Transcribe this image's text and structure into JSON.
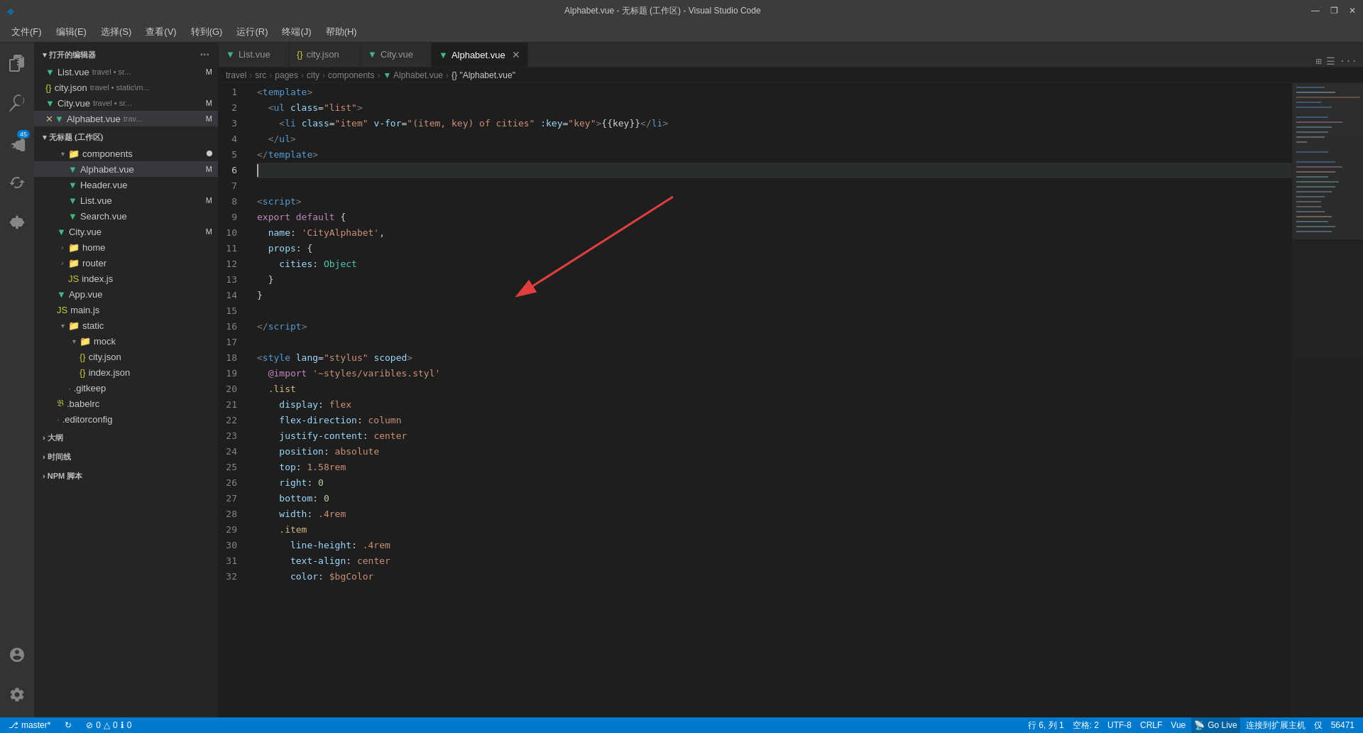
{
  "titleBar": {
    "title": "Alphabet.vue - 无标题 (工作区) - Visual Studio Code",
    "menu": [
      "文件(F)",
      "编辑(E)",
      "选择(S)",
      "查看(V)",
      "转到(G)",
      "运行(R)",
      "终端(J)",
      "帮助(H)"
    ],
    "controls": [
      "—",
      "❐",
      "✕"
    ]
  },
  "sidebar": {
    "openEditors": {
      "label": "打开的编辑器",
      "items": [
        {
          "name": "List.vue",
          "path": "travel • sr...",
          "type": "vue",
          "modified": false
        },
        {
          "name": "city.json",
          "path": "travel • static\\m...",
          "type": "json",
          "modified": false
        },
        {
          "name": "City.vue",
          "path": "travel • sr...",
          "type": "vue",
          "modified": false
        },
        {
          "name": "Alphabet.vue",
          "path": "trav...",
          "type": "vue",
          "modified": true,
          "active": true
        }
      ]
    },
    "workspace": {
      "label": "无标题 (工作区)",
      "items": [
        {
          "name": "components",
          "type": "folder",
          "indent": 2,
          "expanded": true,
          "newDot": true
        },
        {
          "name": "Alphabet.vue",
          "type": "vue",
          "indent": 3,
          "modified": true,
          "active": true
        },
        {
          "name": "Header.vue",
          "type": "vue",
          "indent": 3
        },
        {
          "name": "List.vue",
          "type": "vue",
          "indent": 3,
          "modified": true
        },
        {
          "name": "Search.vue",
          "type": "vue",
          "indent": 3
        },
        {
          "name": "City.vue",
          "type": "vue",
          "indent": 2,
          "modified": true
        },
        {
          "name": "home",
          "type": "folder",
          "indent": 2,
          "expanded": false
        },
        {
          "name": "router",
          "type": "folder",
          "indent": 2,
          "expanded": false
        },
        {
          "name": "index.js",
          "type": "js",
          "indent": 3
        },
        {
          "name": "App.vue",
          "type": "vue",
          "indent": 2
        },
        {
          "name": "main.js",
          "type": "js",
          "indent": 2
        },
        {
          "name": "static",
          "type": "folder",
          "indent": 2,
          "expanded": true
        },
        {
          "name": "mock",
          "type": "folder",
          "indent": 3,
          "expanded": true
        },
        {
          "name": "city.json",
          "type": "json",
          "indent": 4
        },
        {
          "name": "index.json",
          "type": "json",
          "indent": 4
        },
        {
          "name": ".gitkeep",
          "type": "dot",
          "indent": 3
        },
        {
          "name": ".babelrc",
          "type": "dot",
          "indent": 2
        },
        {
          "name": ".editorconfig",
          "type": "dot",
          "indent": 2
        },
        {
          "name": "大纲",
          "type": "folder-closed",
          "indent": 0
        },
        {
          "name": "时间线",
          "type": "folder-closed",
          "indent": 0
        },
        {
          "name": "NPM 脚本",
          "type": "folder-closed",
          "indent": 0
        }
      ]
    }
  },
  "tabs": [
    {
      "name": "List.vue",
      "type": "vue",
      "active": false
    },
    {
      "name": "city.json",
      "type": "json",
      "active": false
    },
    {
      "name": "City.vue",
      "type": "vue",
      "active": false
    },
    {
      "name": "Alphabet.vue",
      "type": "vue",
      "active": true,
      "closable": true
    }
  ],
  "breadcrumb": [
    "travel",
    "src",
    "pages",
    "city",
    "components",
    "Alphabet.vue",
    "{} \"Alphabet.vue\""
  ],
  "code": {
    "lines": [
      {
        "num": 1,
        "tokens": [
          {
            "t": "<",
            "c": "tag"
          },
          {
            "t": "template",
            "c": "tag-name"
          },
          {
            "t": ">",
            "c": "tag"
          }
        ]
      },
      {
        "num": 2,
        "tokens": [
          {
            "t": "  <",
            "c": "tag"
          },
          {
            "t": "ul",
            "c": "tag-name"
          },
          {
            "t": " ",
            "c": "text"
          },
          {
            "t": "class",
            "c": "attr-name"
          },
          {
            "t": "=",
            "c": "attr-equals"
          },
          {
            "t": "\"list\"",
            "c": "attr-value"
          },
          {
            "t": ">",
            "c": "tag"
          }
        ]
      },
      {
        "num": 3,
        "tokens": [
          {
            "t": "    <",
            "c": "tag"
          },
          {
            "t": "li",
            "c": "tag-name"
          },
          {
            "t": " ",
            "c": "text"
          },
          {
            "t": "class",
            "c": "attr-name"
          },
          {
            "t": "=",
            "c": "attr-equals"
          },
          {
            "t": "\"item\"",
            "c": "attr-value"
          },
          {
            "t": " ",
            "c": "text"
          },
          {
            "t": "v-for",
            "c": "attr-name"
          },
          {
            "t": "=",
            "c": "attr-equals"
          },
          {
            "t": "\"(item, key) of cities\"",
            "c": "attr-value"
          },
          {
            "t": " ",
            "c": "text"
          },
          {
            "t": ":key",
            "c": "attr-name"
          },
          {
            "t": "=",
            "c": "attr-equals"
          },
          {
            "t": "\"key\"",
            "c": "attr-value"
          },
          {
            "t": ">",
            "c": "tag"
          },
          {
            "t": "{{key}}",
            "c": "interpolation"
          },
          {
            "t": "</",
            "c": "tag"
          },
          {
            "t": "li",
            "c": "tag-name"
          },
          {
            "t": ">",
            "c": "tag"
          }
        ]
      },
      {
        "num": 4,
        "tokens": [
          {
            "t": "  </",
            "c": "tag"
          },
          {
            "t": "ul",
            "c": "tag-name"
          },
          {
            "t": ">",
            "c": "tag"
          }
        ]
      },
      {
        "num": 5,
        "tokens": [
          {
            "t": "</",
            "c": "tag"
          },
          {
            "t": "template",
            "c": "tag-name"
          },
          {
            "t": ">",
            "c": "tag"
          }
        ]
      },
      {
        "num": 6,
        "tokens": [],
        "active": true,
        "cursor": true
      },
      {
        "num": 7,
        "tokens": []
      },
      {
        "num": 8,
        "tokens": [
          {
            "t": "<",
            "c": "tag"
          },
          {
            "t": "script",
            "c": "tag-name"
          },
          {
            "t": ">",
            "c": "tag"
          }
        ]
      },
      {
        "num": 9,
        "tokens": [
          {
            "t": "export ",
            "c": "keyword"
          },
          {
            "t": "default",
            "c": "keyword"
          },
          {
            "t": " {",
            "c": "punctuation"
          }
        ]
      },
      {
        "num": 10,
        "tokens": [
          {
            "t": "  ",
            "c": "text"
          },
          {
            "t": "name",
            "c": "property"
          },
          {
            "t": ": ",
            "c": "punctuation"
          },
          {
            "t": "'CityAlphabet'",
            "c": "string"
          },
          {
            "t": ",",
            "c": "punctuation"
          }
        ]
      },
      {
        "num": 11,
        "tokens": [
          {
            "t": "  ",
            "c": "text"
          },
          {
            "t": "props",
            "c": "property"
          },
          {
            "t": ": {",
            "c": "punctuation"
          }
        ]
      },
      {
        "num": 12,
        "tokens": [
          {
            "t": "    ",
            "c": "text"
          },
          {
            "t": "cities",
            "c": "property"
          },
          {
            "t": ": ",
            "c": "punctuation"
          },
          {
            "t": "Object",
            "c": "class-name"
          }
        ]
      },
      {
        "num": 13,
        "tokens": [
          {
            "t": "  }",
            "c": "punctuation"
          }
        ]
      },
      {
        "num": 14,
        "tokens": [
          {
            "t": "}",
            "c": "punctuation"
          }
        ]
      },
      {
        "num": 15,
        "tokens": []
      },
      {
        "num": 16,
        "tokens": [
          {
            "t": "</",
            "c": "tag"
          },
          {
            "t": "script",
            "c": "tag-name"
          },
          {
            "t": ">",
            "c": "tag"
          }
        ]
      },
      {
        "num": 17,
        "tokens": []
      },
      {
        "num": 18,
        "tokens": [
          {
            "t": "<",
            "c": "tag"
          },
          {
            "t": "style",
            "c": "tag-name"
          },
          {
            "t": " ",
            "c": "text"
          },
          {
            "t": "lang",
            "c": "attr-name"
          },
          {
            "t": "=",
            "c": "attr-equals"
          },
          {
            "t": "\"stylus\"",
            "c": "attr-value"
          },
          {
            "t": " ",
            "c": "text"
          },
          {
            "t": "scoped",
            "c": "attr-name"
          },
          {
            "t": ">",
            "c": "tag"
          }
        ]
      },
      {
        "num": 19,
        "tokens": [
          {
            "t": "  ",
            "c": "text"
          },
          {
            "t": "@import",
            "c": "keyword"
          },
          {
            "t": " ",
            "c": "text"
          },
          {
            "t": "'~styles/varibles.styl'",
            "c": "string"
          }
        ]
      },
      {
        "num": 20,
        "tokens": [
          {
            "t": "  ",
            "c": "text"
          },
          {
            "t": ".list",
            "c": "style-prop"
          }
        ]
      },
      {
        "num": 21,
        "tokens": [
          {
            "t": "    ",
            "c": "text"
          },
          {
            "t": "display",
            "c": "style-prop"
          },
          {
            "t": ": ",
            "c": "punctuation"
          },
          {
            "t": "flex",
            "c": "style-val"
          }
        ]
      },
      {
        "num": 22,
        "tokens": [
          {
            "t": "    ",
            "c": "text"
          },
          {
            "t": "flex-direction",
            "c": "style-prop"
          },
          {
            "t": ": ",
            "c": "punctuation"
          },
          {
            "t": "column",
            "c": "style-val"
          }
        ]
      },
      {
        "num": 23,
        "tokens": [
          {
            "t": "    ",
            "c": "text"
          },
          {
            "t": "justify-content",
            "c": "style-prop"
          },
          {
            "t": ": ",
            "c": "punctuation"
          },
          {
            "t": "center",
            "c": "style-val"
          }
        ]
      },
      {
        "num": 24,
        "tokens": [
          {
            "t": "    ",
            "c": "text"
          },
          {
            "t": "position",
            "c": "style-prop"
          },
          {
            "t": ": ",
            "c": "punctuation"
          },
          {
            "t": "absolute",
            "c": "style-val"
          }
        ]
      },
      {
        "num": 25,
        "tokens": [
          {
            "t": "    ",
            "c": "text"
          },
          {
            "t": "top",
            "c": "style-prop"
          },
          {
            "t": ": ",
            "c": "punctuation"
          },
          {
            "t": "1.58rem",
            "c": "style-val"
          }
        ]
      },
      {
        "num": 26,
        "tokens": [
          {
            "t": "    ",
            "c": "text"
          },
          {
            "t": "right",
            "c": "style-prop"
          },
          {
            "t": ": ",
            "c": "punctuation"
          },
          {
            "t": "0",
            "c": "number"
          }
        ]
      },
      {
        "num": 27,
        "tokens": [
          {
            "t": "    ",
            "c": "text"
          },
          {
            "t": "bottom",
            "c": "style-prop"
          },
          {
            "t": ": ",
            "c": "punctuation"
          },
          {
            "t": "0",
            "c": "number"
          }
        ]
      },
      {
        "num": 28,
        "tokens": [
          {
            "t": "    ",
            "c": "text"
          },
          {
            "t": "width",
            "c": "style-prop"
          },
          {
            "t": ": ",
            "c": "punctuation"
          },
          {
            "t": ".4rem",
            "c": "style-val"
          }
        ]
      },
      {
        "num": 29,
        "tokens": [
          {
            "t": "    ",
            "c": "text"
          },
          {
            "t": ".item",
            "c": "style-prop"
          }
        ]
      },
      {
        "num": 30,
        "tokens": [
          {
            "t": "      ",
            "c": "text"
          },
          {
            "t": "line-height",
            "c": "style-prop"
          },
          {
            "t": ": ",
            "c": "punctuation"
          },
          {
            "t": ".4rem",
            "c": "style-val"
          }
        ]
      },
      {
        "num": 31,
        "tokens": [
          {
            "t": "      ",
            "c": "text"
          },
          {
            "t": "text-align",
            "c": "style-prop"
          },
          {
            "t": ": ",
            "c": "punctuation"
          },
          {
            "t": "center",
            "c": "style-val"
          }
        ]
      },
      {
        "num": 32,
        "tokens": [
          {
            "t": "      ",
            "c": "text"
          },
          {
            "t": "color",
            "c": "style-prop"
          },
          {
            "t": ": ",
            "c": "punctuation"
          },
          {
            "t": "$bgColor",
            "c": "style-val"
          }
        ]
      }
    ]
  },
  "statusBar": {
    "left": [
      {
        "icon": "⎇",
        "text": "master*"
      },
      {
        "icon": "↻",
        "text": ""
      },
      {
        "icon": "⊘",
        "text": "0"
      },
      {
        "icon": "△",
        "text": "0"
      },
      {
        "icon": "ℹ",
        "text": "0"
      }
    ],
    "right": [
      {
        "text": "行 6, 列 1"
      },
      {
        "text": "空格: 2"
      },
      {
        "text": "UTF-8"
      },
      {
        "text": "CRLF"
      },
      {
        "text": "Vue"
      },
      {
        "text": "Go Live"
      },
      {
        "text": "连接到扩展主机"
      },
      {
        "text": "仅"
      },
      {
        "text": "56471"
      }
    ]
  }
}
